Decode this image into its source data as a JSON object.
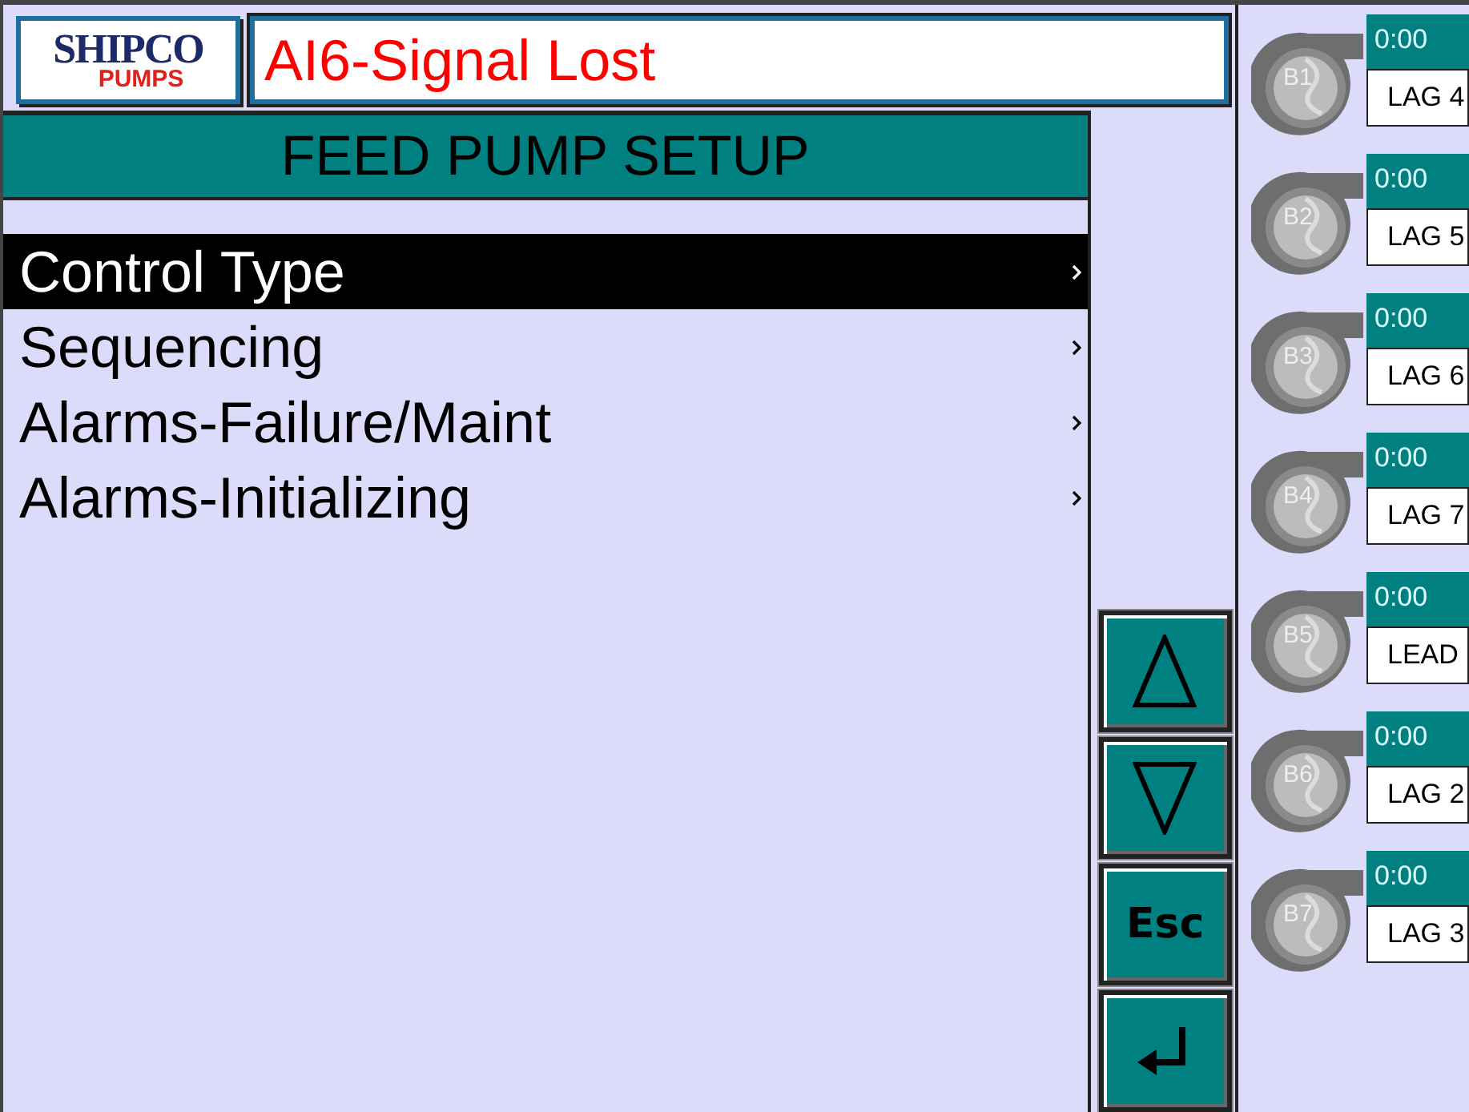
{
  "logo": {
    "top": "SHIPCO",
    "bottom": "PUMPS"
  },
  "alarm": {
    "value": "AI6-Signal Lost"
  },
  "header": {
    "title": "FEED PUMP SETUP"
  },
  "menu": [
    {
      "label": "Control Type",
      "selected": true
    },
    {
      "label": "Sequencing",
      "selected": false
    },
    {
      "label": "Alarms-Failure/Maint",
      "selected": false
    },
    {
      "label": "Alarms-Initializing",
      "selected": false
    }
  ],
  "buttons": [
    {
      "kind": "up"
    },
    {
      "kind": "down"
    },
    {
      "kind": "text",
      "label": "Esc"
    },
    {
      "kind": "enter"
    }
  ],
  "pumps": [
    {
      "name": "B1",
      "time": "0:00",
      "role": "LAG 4"
    },
    {
      "name": "B2",
      "time": "0:00",
      "role": "LAG 5"
    },
    {
      "name": "B3",
      "time": "0:00",
      "role": "LAG 6"
    },
    {
      "name": "B4",
      "time": "0:00",
      "role": "LAG 7"
    },
    {
      "name": "B5",
      "time": "0:00",
      "role": "LEAD"
    },
    {
      "name": "B6",
      "time": "0:00",
      "role": "LAG 2"
    },
    {
      "name": "B7",
      "time": "0:00",
      "role": "LAG 3"
    }
  ]
}
